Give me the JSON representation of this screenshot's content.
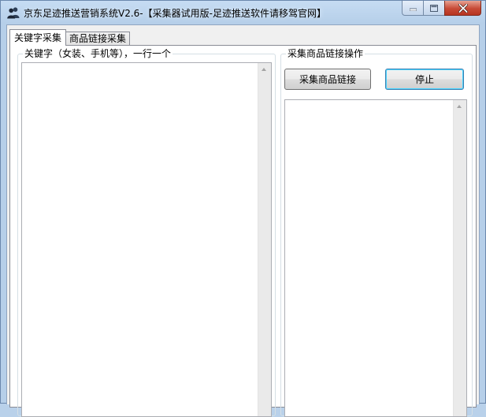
{
  "window": {
    "title": "京东足迹推送营销系统V2.6-【采集器试用版-足迹推送软件请移驾官网】",
    "icon": "users-icon"
  },
  "caption_buttons": {
    "minimize_icon": "minimize-icon",
    "maximize_icon": "maximize-icon",
    "close_icon": "close-icon"
  },
  "tabs": [
    {
      "label": "关键字采集",
      "active": true
    },
    {
      "label": "商品链接采集",
      "active": false
    }
  ],
  "keyword_panel": {
    "legend": "关键字（女装、手机等），一行一个",
    "input_value": ""
  },
  "link_panel": {
    "legend": "采集商品链接操作",
    "collect_button": "采集商品链接",
    "stop_button": "停止",
    "output_value": ""
  }
}
